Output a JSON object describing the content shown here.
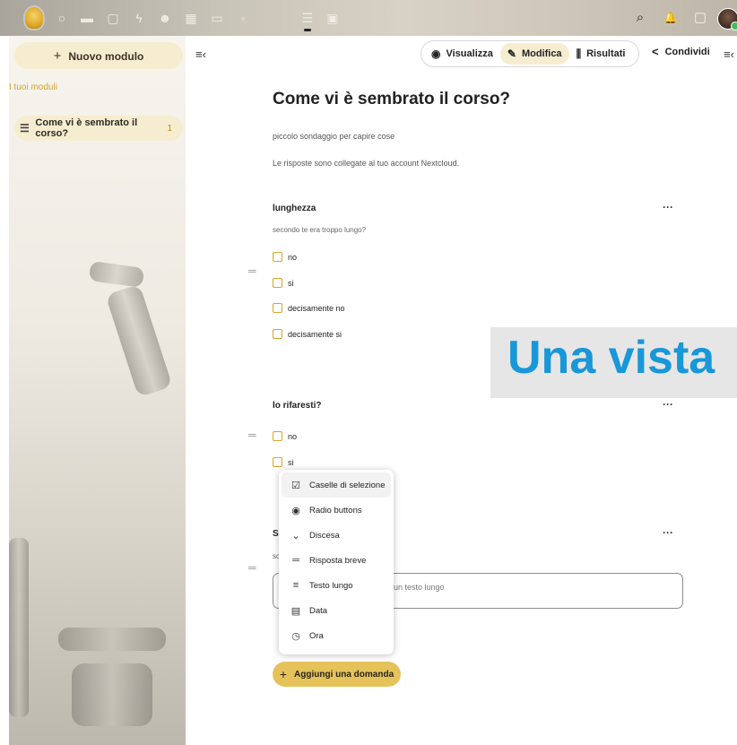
{
  "topbar": {
    "apps": [
      {
        "icon": "circle-icon",
        "glyph": "○"
      },
      {
        "icon": "folder-icon",
        "glyph": "▬"
      },
      {
        "icon": "image-icon",
        "glyph": "▢"
      },
      {
        "icon": "activity-icon",
        "glyph": "ϟ"
      },
      {
        "icon": "contacts-icon",
        "glyph": "☻"
      },
      {
        "icon": "calendar-icon",
        "glyph": "▦"
      },
      {
        "icon": "deck-icon",
        "glyph": "▭"
      },
      {
        "icon": "talk-icon",
        "glyph": "◦"
      },
      {
        "icon": "forms-icon",
        "glyph": "☰"
      },
      {
        "icon": "notes-icon",
        "glyph": "▣"
      }
    ],
    "right": {
      "search": "⌕",
      "notifications": "🔔",
      "contacts": "▢"
    }
  },
  "sidebar": {
    "new_form_label": "Nuovo modulo",
    "section_caption": "I tuoi moduli",
    "forms": [
      {
        "title": "Come vi è sembrato il corso?",
        "count": "1"
      }
    ]
  },
  "toolbar": {
    "view_label": "Visualizza",
    "edit_label": "Modifica",
    "results_label": "Risultati",
    "share_label": "Condividi"
  },
  "form": {
    "title": "Come vi è sembrato il corso?",
    "description": "piccolo sondaggio per capire cose",
    "note": "Le risposte sono collegate al tuo account Nextcloud."
  },
  "questions": [
    {
      "title": "lunghezza",
      "description": "secondo te era troppo lungo?",
      "options": [
        "no",
        "si",
        "decisamente no",
        "decisamente si"
      ]
    },
    {
      "title": "lo rifaresti?",
      "options": [
        "no",
        "si"
      ]
    },
    {
      "title_fragment": "S",
      "description_fragment": "sc",
      "placeholder_fragment": "un testo lungo"
    }
  ],
  "menu": {
    "items": [
      {
        "label": "Caselle di selezione",
        "icon": "☑"
      },
      {
        "label": "Radio buttons",
        "icon": "◉"
      },
      {
        "label": "Discesa",
        "icon": "⌄"
      },
      {
        "label": "Risposta breve",
        "icon": "═"
      },
      {
        "label": "Testo lungo",
        "icon": "≡"
      },
      {
        "label": "Data",
        "icon": "▤"
      },
      {
        "label": "Ora",
        "icon": "◷"
      }
    ]
  },
  "add_question_label": "Aggiungi una domanda",
  "banner_text": "Una vista",
  "colors": {
    "accent": "#e6c25a",
    "accent_light": "#f6edd1",
    "caption": "#d1a52b",
    "banner_text": "#1897d9"
  }
}
